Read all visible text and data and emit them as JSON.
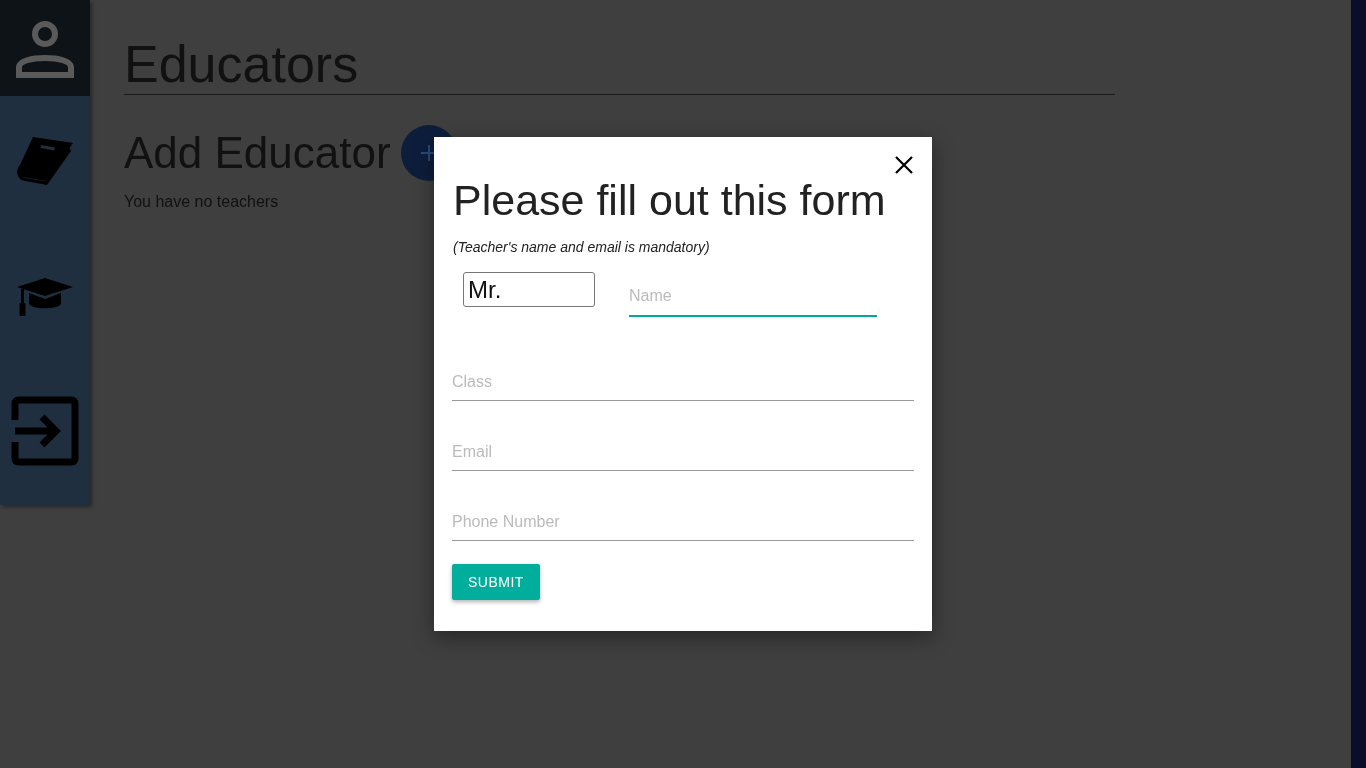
{
  "sidebar": {
    "items": [
      {
        "kind": "profile",
        "selected": true
      },
      {
        "kind": "book",
        "selected": false
      },
      {
        "kind": "graduation",
        "selected": false
      },
      {
        "kind": "sign-in",
        "selected": false
      }
    ]
  },
  "page": {
    "title": "Educators",
    "add_heading": "Add Educator",
    "empty_message": "You have no teachers"
  },
  "modal": {
    "title": "Please fill out this form",
    "note": "(Teacher's name and email is mandatory)",
    "salutation": {
      "value": "Mr."
    },
    "name_field": {
      "placeholder": "Name",
      "focused": true
    },
    "fields": [
      {
        "placeholder": "Class"
      },
      {
        "placeholder": "Email"
      },
      {
        "placeholder": "Phone Number"
      }
    ],
    "submit": "SUBMIT"
  }
}
